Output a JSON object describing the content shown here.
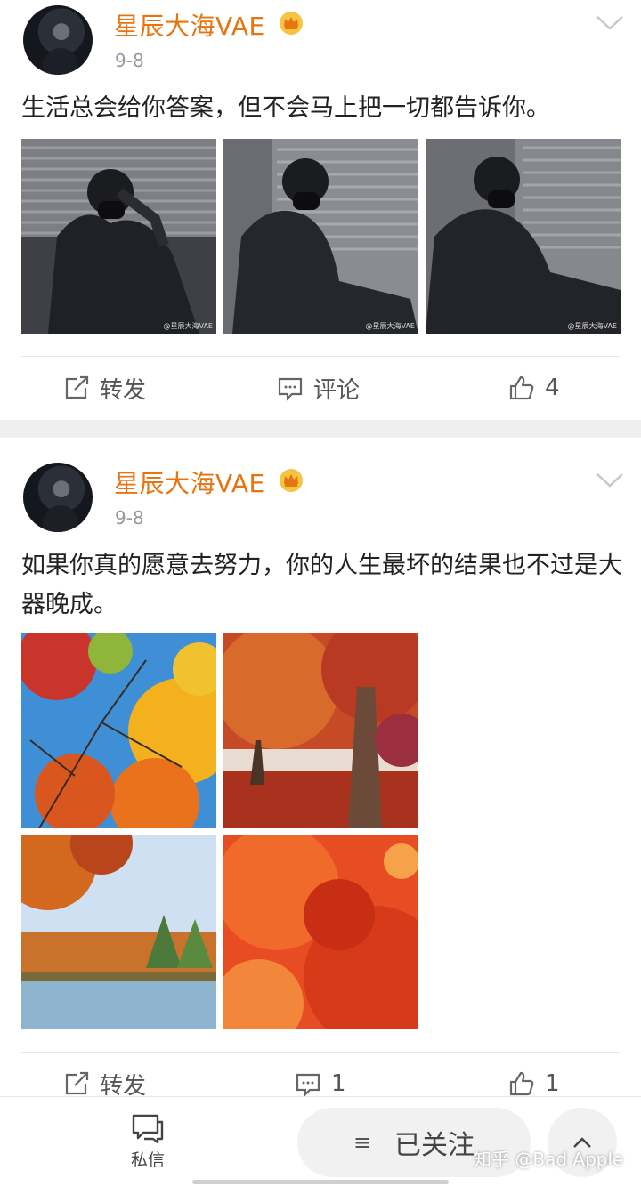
{
  "posts": [
    {
      "username": "星辰大海VAE",
      "date": "9-8",
      "text": "生活总会给你答案，但不会马上把一切都告诉你。",
      "image_watermark": "@星辰大海VAE",
      "actions": {
        "repost_label": "转发",
        "comment_label": "评论",
        "like_count": "4"
      }
    },
    {
      "username": "星辰大海VAE",
      "date": "9-8",
      "text": "如果你真的愿意去努力，你的人生最坏的结果也不过是大器晚成。",
      "actions": {
        "repost_label": "转发",
        "comment_count": "1",
        "like_count": "1"
      }
    }
  ],
  "bottom_bar": {
    "dm_label": "私信",
    "follow_label": "已关注",
    "menu_icon": "≡",
    "up_icon": "chevron-up-icon"
  },
  "watermark": "知乎 @Bad Apple",
  "colors": {
    "username": "#e8740f",
    "separator": "#efefef",
    "button_bg": "#f1f1f1"
  }
}
